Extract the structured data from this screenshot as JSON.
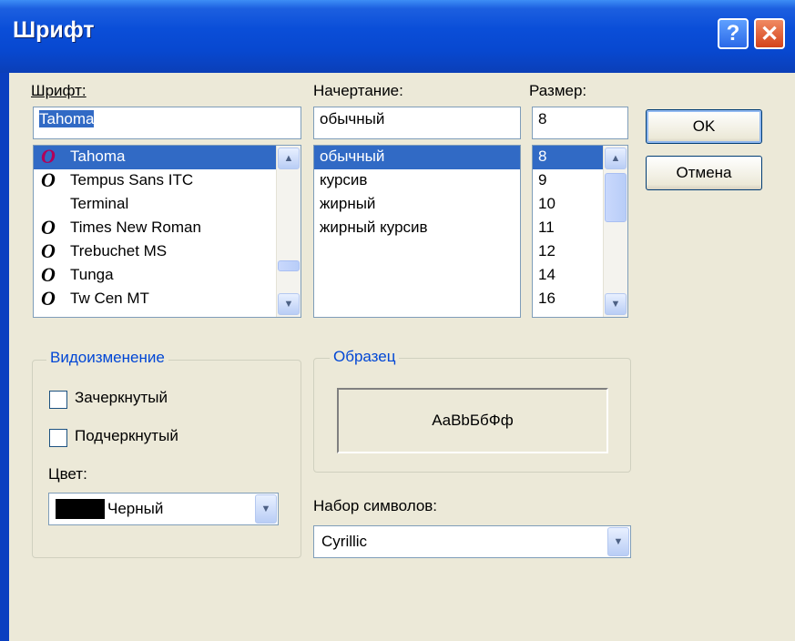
{
  "window": {
    "title": "Шрифт",
    "help_label": "?",
    "close_label": "✕"
  },
  "font": {
    "label": "Шрифт:",
    "value": "Tahoma",
    "items": [
      "Tahoma",
      "Tempus Sans ITC",
      "Terminal",
      "Times New Roman",
      "Trebuchet MS",
      "Tunga",
      "Tw Cen MT"
    ],
    "icons": [
      "O",
      "O",
      "",
      "O",
      "O",
      "O",
      "O"
    ]
  },
  "style": {
    "label": "Начертание:",
    "value": "обычный",
    "items": [
      "обычный",
      "курсив",
      "жирный",
      "жирный курсив"
    ]
  },
  "size": {
    "label": "Размер:",
    "value": "8",
    "items": [
      "8",
      "9",
      "10",
      "11",
      "12",
      "14",
      "16"
    ]
  },
  "buttons": {
    "ok": "OK",
    "cancel": "Отмена"
  },
  "effects": {
    "title": "Видоизменение",
    "strikeout": "Зачеркнутый",
    "underline": "Подчеркнутый",
    "color_label": "Цвет:",
    "color_value": "Черный",
    "color_swatch": "#000000"
  },
  "sample": {
    "title": "Образец",
    "text": "AaBbБбФф"
  },
  "charset": {
    "label": "Набор символов:",
    "value": "Cyrillic"
  },
  "colors": {
    "selection": "#316ac5",
    "dialog_bg": "#ece9d8",
    "titlebar": "#0a4ed8",
    "group_title": "#0046d5"
  }
}
